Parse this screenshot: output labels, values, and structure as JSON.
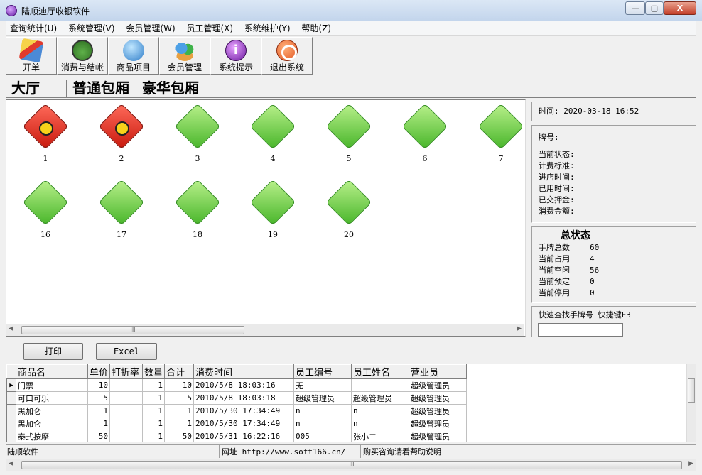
{
  "window": {
    "title": "陆顺迪厅收银软件",
    "min_glyph": "—",
    "max_glyph": "▢",
    "close_glyph": "X"
  },
  "menu": [
    "查询统计(U)",
    "系统管理(V)",
    "会员管理(W)",
    "员工管理(X)",
    "系统维护(Y)",
    "帮助(Z)"
  ],
  "toolbar": [
    {
      "label": "开单",
      "icon": "brush-icon"
    },
    {
      "label": "消费与结帐",
      "icon": "money-bag-icon"
    },
    {
      "label": "商品项目",
      "icon": "apple-icon"
    },
    {
      "label": "会员管理",
      "icon": "users-icon"
    },
    {
      "label": "系统提示",
      "icon": "info-icon"
    },
    {
      "label": "退出系统",
      "icon": "no-entry-icon"
    }
  ],
  "tabs": [
    "大厅",
    "普通包厢",
    "豪华包厢"
  ],
  "rooms": [
    {
      "number": "1",
      "status": "busy"
    },
    {
      "number": "2",
      "status": "busy"
    },
    {
      "number": "3",
      "status": "free"
    },
    {
      "number": "4",
      "status": "free"
    },
    {
      "number": "5",
      "status": "free"
    },
    {
      "number": "6",
      "status": "free"
    },
    {
      "number": "7",
      "status": "free"
    },
    {
      "number": "16",
      "status": "free"
    },
    {
      "number": "17",
      "status": "free"
    },
    {
      "number": "18",
      "status": "free"
    },
    {
      "number": "19",
      "status": "free"
    },
    {
      "number": "20",
      "status": "free"
    }
  ],
  "info": {
    "time": "时间: 2020-03-18 16:52",
    "plate_label": "牌号:",
    "fields": [
      "当前状态:",
      "计费标准:",
      "进店时间:",
      "已用时间:",
      "已交押金:",
      "消费金额:"
    ]
  },
  "stats": {
    "title": "总状态",
    "rows": [
      {
        "k": "手牌总数",
        "v": "60"
      },
      {
        "k": "当前占用",
        "v": "4"
      },
      {
        "k": "当前空闲",
        "v": "56"
      },
      {
        "k": "当前预定",
        "v": "0"
      },
      {
        "k": "当前停用",
        "v": "0"
      }
    ]
  },
  "search": {
    "label": "快速查找手牌号  快捷键F3",
    "value": ""
  },
  "buttons": {
    "print": "打印",
    "excel": "Excel"
  },
  "grid": {
    "columns": [
      "商品名",
      "单价",
      "打折率",
      "数量",
      "合计",
      "消费时间",
      "员工编号",
      "员工姓名",
      "营业员"
    ],
    "rows": [
      [
        "门票",
        "10",
        "",
        "1",
        "10",
        "2010/5/8 18:03:16",
        "无",
        "",
        "超级管理员"
      ],
      [
        "可口可乐",
        "5",
        "",
        "1",
        "5",
        "2010/5/8 18:03:18",
        "超级管理员",
        "超级管理员",
        "超级管理员"
      ],
      [
        "黑加仑",
        "1",
        "",
        "1",
        "1",
        "2010/5/30 17:34:49",
        "n",
        "n",
        "超级管理员"
      ],
      [
        "黑加仑",
        "1",
        "",
        "1",
        "1",
        "2010/5/30 17:34:49",
        "n",
        "n",
        "超级管理员"
      ],
      [
        "泰式按摩",
        "50",
        "",
        "1",
        "50",
        "2010/5/31 16:22:16",
        "005",
        "张小二",
        "超级管理员"
      ]
    ]
  },
  "status_bar": {
    "company": "陆顺软件",
    "website": "网址 http://www.soft166.cn/",
    "help": "购买咨询请看帮助说明"
  },
  "scroll_grip": "III"
}
